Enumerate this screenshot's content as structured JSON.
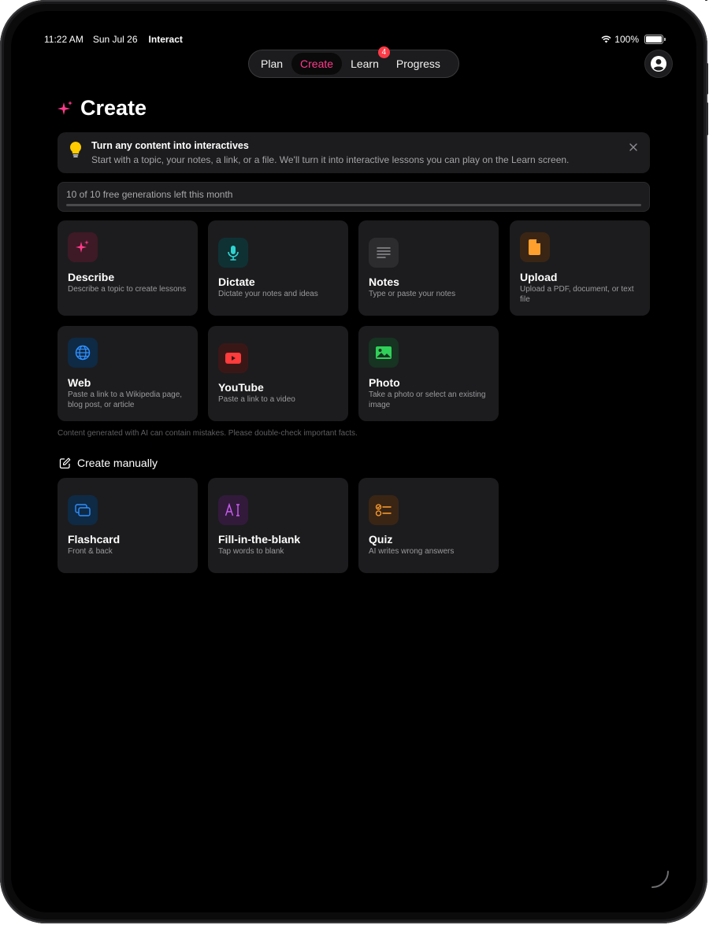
{
  "status": {
    "time": "11:22 AM",
    "date": "Sun Jul 26",
    "app": "Interact",
    "battery": "100%"
  },
  "nav": {
    "tabs": [
      {
        "label": "Plan"
      },
      {
        "label": "Create",
        "active": true
      },
      {
        "label": "Learn",
        "badge": "4"
      },
      {
        "label": "Progress"
      }
    ]
  },
  "page": {
    "title": "Create"
  },
  "banner": {
    "title": "Turn any content into interactives",
    "description": "Start with a topic, your notes, a link, or a file. We'll turn it into interactive lessons you can play on the Learn screen."
  },
  "usage": {
    "text": "10 of 10 free generations left this month",
    "used_fraction": 1.0
  },
  "sources": [
    {
      "name": "Describe",
      "desc": "Describe a topic to create lessons",
      "icon": "sparkles-icon",
      "bg": "#3d1a25",
      "fg": "#ff3b8a"
    },
    {
      "name": "Dictate",
      "desc": "Dictate your notes and ideas",
      "icon": "microphone-icon",
      "bg": "#0f3134",
      "fg": "#2fd4d1"
    },
    {
      "name": "Notes",
      "desc": "Type or paste your notes",
      "icon": "lines-icon",
      "bg": "#2c2c2e",
      "fg": "#8e8e93"
    },
    {
      "name": "Upload",
      "desc": "Upload a PDF, document, or text file",
      "icon": "document-icon",
      "bg": "#3a2515",
      "fg": "#ff9f2e"
    },
    {
      "name": "Web",
      "desc": "Paste a link to a Wikipedia page, blog post, or article",
      "icon": "globe-icon",
      "bg": "#0f2a44",
      "fg": "#2f8fff"
    },
    {
      "name": "YouTube",
      "desc": "Paste a link to a video",
      "icon": "play-icon",
      "bg": "#3a1717",
      "fg": "#ff3b3b"
    },
    {
      "name": "Photo",
      "desc": "Take a photo or select an existing image",
      "icon": "image-icon",
      "bg": "#173322",
      "fg": "#30d158"
    }
  ],
  "disclaimer": "Content generated with AI can contain mistakes. Please double-check important facts.",
  "manual": {
    "heading": "Create manually",
    "items": [
      {
        "name": "Flashcard",
        "desc": "Front & back",
        "icon": "cards-icon",
        "bg": "#0f2a44",
        "fg": "#2f8fff"
      },
      {
        "name": "Fill-in-the-blank",
        "desc": "Tap words to blank",
        "icon": "text-cursor-icon",
        "bg": "#321a3b",
        "fg": "#c95cf0"
      },
      {
        "name": "Quiz",
        "desc": "AI writes wrong answers",
        "icon": "checklist-icon",
        "bg": "#3a2515",
        "fg": "#ff9f2e"
      }
    ]
  },
  "colors": {
    "accent": "#ff3b8a",
    "card": "#1c1c1e",
    "background": "#000000"
  }
}
